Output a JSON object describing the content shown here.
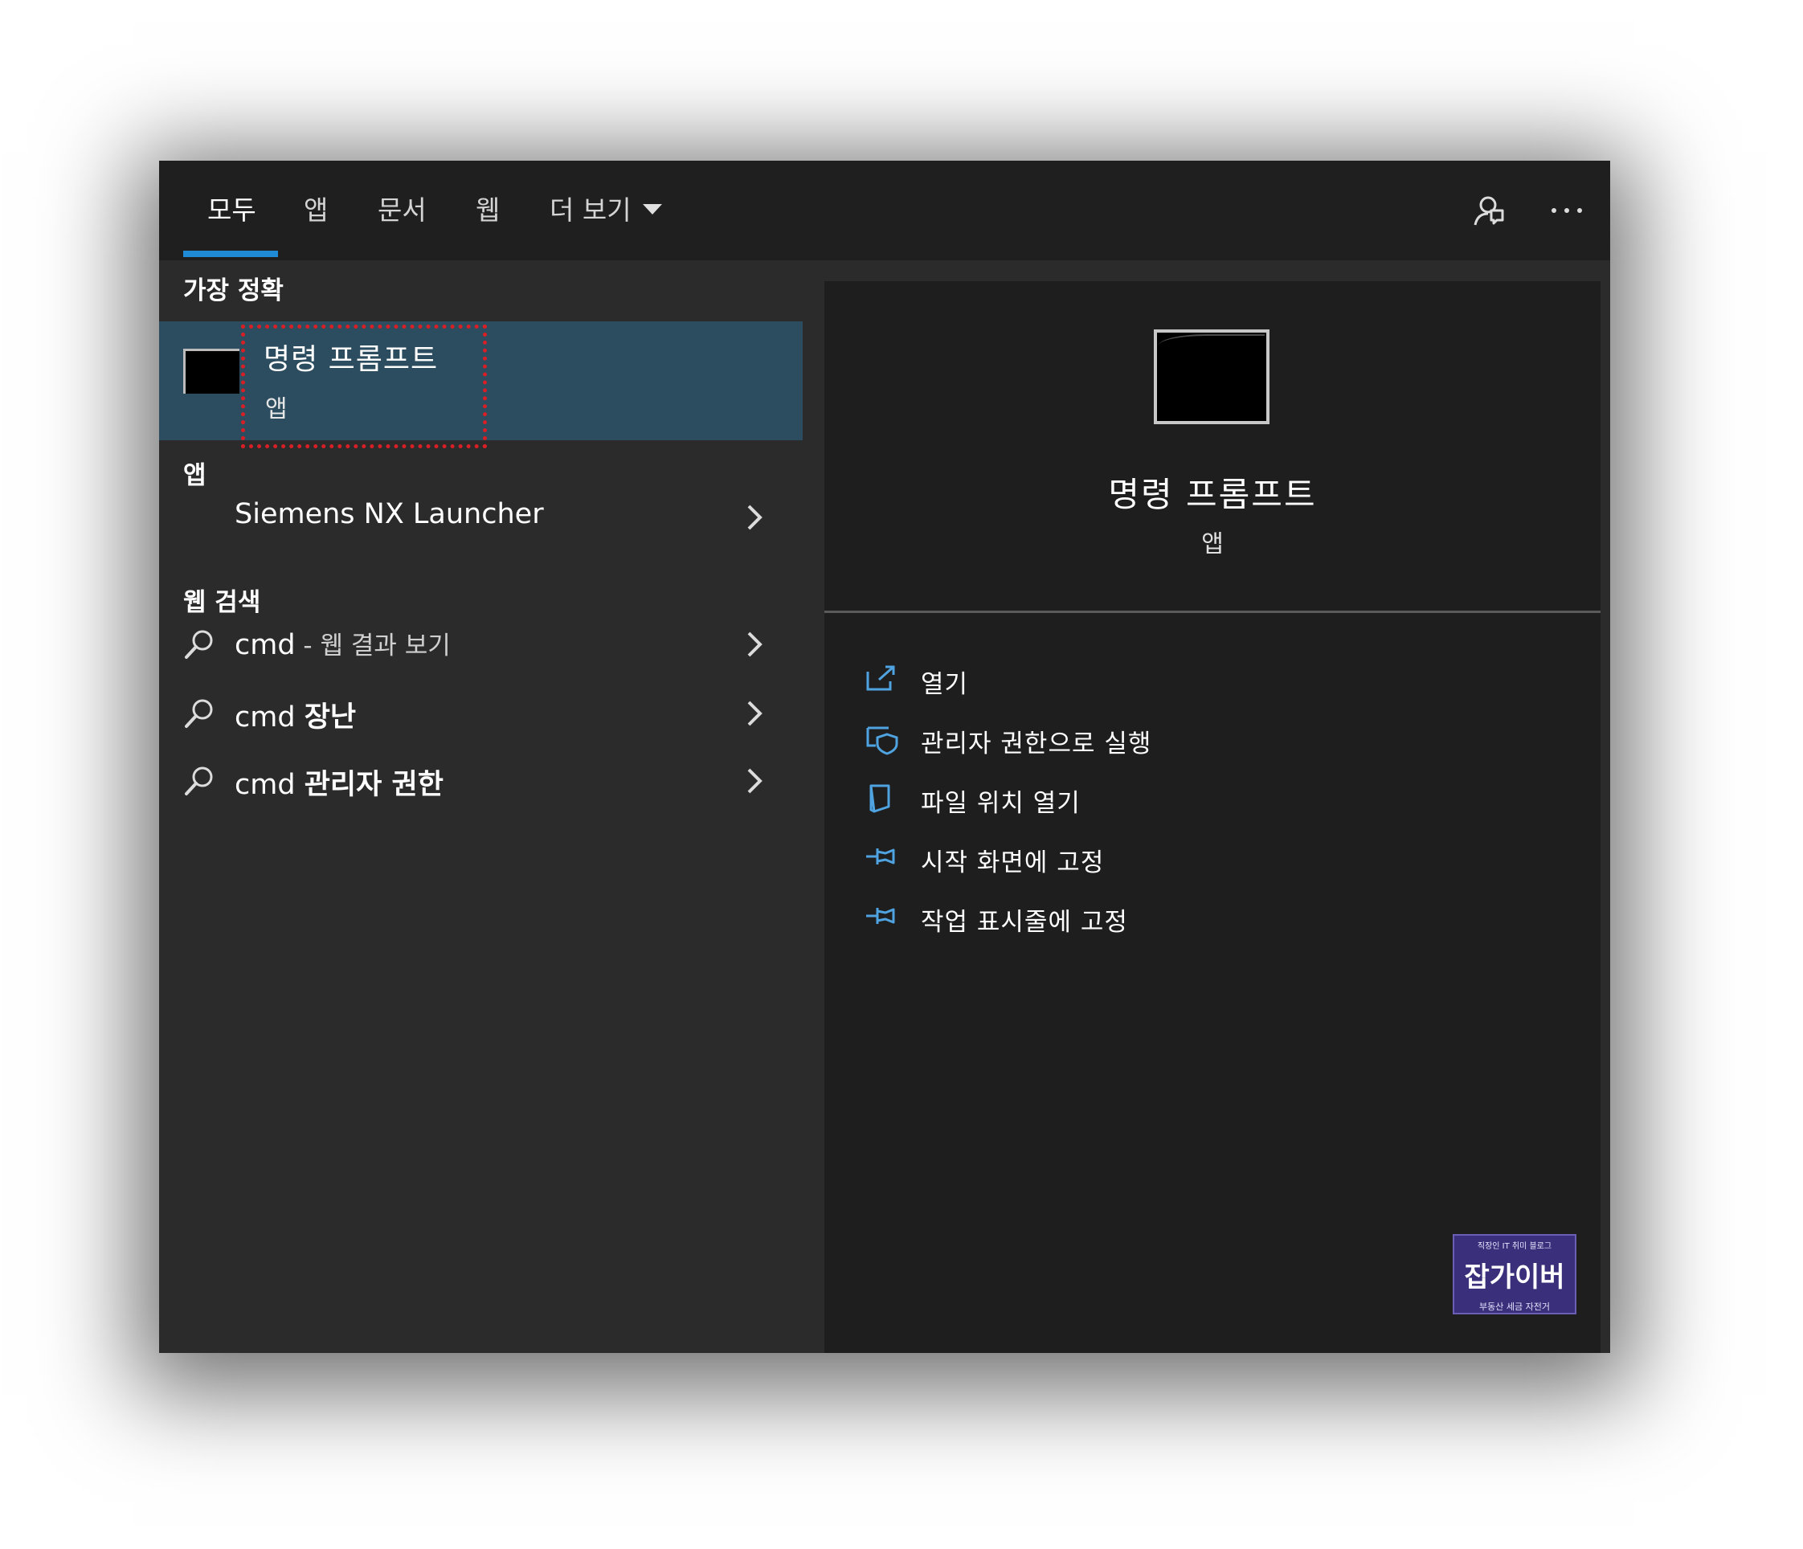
{
  "tabs": {
    "all": "모두",
    "apps": "앱",
    "documents": "문서",
    "web": "웹",
    "more": "더 보기"
  },
  "top_icons": [
    "feedback-icon",
    "more-options-icon"
  ],
  "left": {
    "best_match_header": "가장 정확",
    "best_match": {
      "title": "명령 프롬프트",
      "subtitle": "앱"
    },
    "apps_header": "앱",
    "apps": [
      {
        "label": "Siemens NX Launcher"
      }
    ],
    "web_header": "웹 검색",
    "web_results": [
      {
        "query": "cmd",
        "suffix": " - 웹 결과 보기"
      },
      {
        "query": "cmd",
        "bold": "장난"
      },
      {
        "query": "cmd",
        "bold": "관리자 권한"
      }
    ]
  },
  "right": {
    "title": "명령 프롬프트",
    "subtitle": "앱",
    "actions": [
      {
        "label": "열기",
        "icon": "open-icon"
      },
      {
        "label": "관리자 권한으로 실행",
        "icon": "shield-icon"
      },
      {
        "label": "파일 위치 열기",
        "icon": "file-location-icon"
      },
      {
        "label": "시작 화면에 고정",
        "icon": "pin-icon"
      },
      {
        "label": "작업 표시줄에 고정",
        "icon": "pin-icon"
      }
    ]
  },
  "watermark": {
    "top": "직장인 IT 취미 블로그",
    "main": "잡가이버",
    "bottom": "부동산 세금 자전거"
  },
  "colors": {
    "accent": "#1f8ad6",
    "selection": "#2b4d5f",
    "highlight_box": "#d81f26"
  }
}
